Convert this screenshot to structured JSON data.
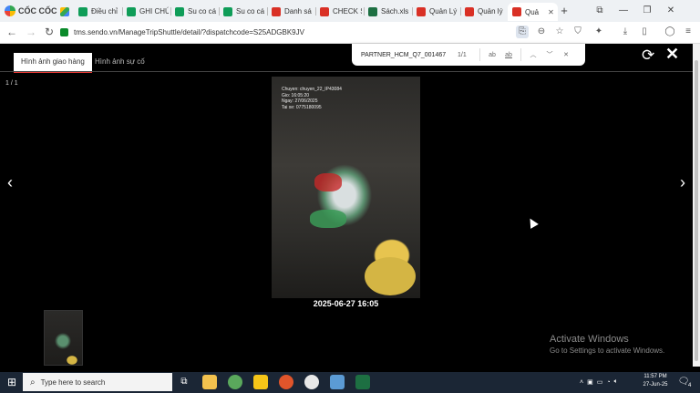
{
  "browser": {
    "brand": "CỐC CỐC",
    "tabs": [
      {
        "label": "",
        "icon": "google-drive-icon"
      },
      {
        "label": "Điều chỉ",
        "icon": "sheets-icon"
      },
      {
        "label": "GHI CHÚ",
        "icon": "sheets-icon"
      },
      {
        "label": "Su co cá",
        "icon": "sheets-icon"
      },
      {
        "label": "Su co cá",
        "icon": "sheets-icon"
      },
      {
        "label": "Danh sá",
        "icon": "sendo-icon"
      },
      {
        "label": "CHECK S",
        "icon": "sendo-icon"
      },
      {
        "label": "Sách.xls",
        "icon": "excel-icon"
      },
      {
        "label": "Quản Lý",
        "icon": "sendo-icon"
      },
      {
        "label": "Quản lý",
        "icon": "sendo-icon"
      },
      {
        "label": "Quả",
        "icon": "sendo-icon",
        "active": true
      }
    ],
    "url": "tms.sendo.vn/ManageTripShuttle/detail/?dispatchcode=S25ADGBK9JV"
  },
  "findbar": {
    "query": "PARTNER_HCM_Q7_001467",
    "count": "1/1",
    "match_case_label": "ab",
    "whole_word_label": "ab"
  },
  "viewer": {
    "tabs": {
      "delivery": "Hình ảnh giao hàng",
      "incident": "Hình ảnh sự cố"
    },
    "counter": "1 / 1",
    "stamp": [
      "Chuyen: chuyen_22_IP43084",
      "Gio: 16:05:20",
      "Ngay: 27/06/2025",
      "Tai xe: 0775180095"
    ],
    "caption": "2025-06-27 16:05"
  },
  "activation": {
    "title": "Activate Windows",
    "subtitle": "Go to Settings to activate Windows."
  },
  "taskbar": {
    "search_placeholder": "Type here to search",
    "time": "11:57 PM",
    "date": "27-Jun-25",
    "notifications": "4"
  }
}
